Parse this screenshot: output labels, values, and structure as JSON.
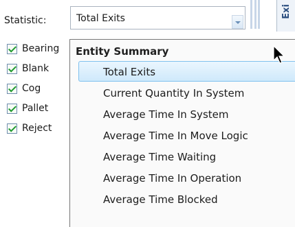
{
  "statistic": {
    "label": "Statistic:",
    "selected_value": "Total Exits",
    "side_tab_text": "Exi"
  },
  "entities": [
    {
      "label": "Bearing",
      "checked": true
    },
    {
      "label": "Blank",
      "checked": true
    },
    {
      "label": "Cog",
      "checked": true
    },
    {
      "label": "Pallet",
      "checked": true
    },
    {
      "label": "Reject",
      "checked": true
    }
  ],
  "dropdown": {
    "group_header": "Entity Summary",
    "options": [
      {
        "label": "Total Exits",
        "selected": true
      },
      {
        "label": "Current Quantity In System",
        "selected": false
      },
      {
        "label": "Average Time In System",
        "selected": false
      },
      {
        "label": "Average Time In Move Logic",
        "selected": false
      },
      {
        "label": "Average Time Waiting",
        "selected": false
      },
      {
        "label": "Average Time In Operation",
        "selected": false
      },
      {
        "label": "Average Time Blocked",
        "selected": false
      }
    ]
  },
  "colors": {
    "selection_border": "#7fc0ee",
    "selection_fill": "#cfe9fb",
    "checkbox_check": "#1f9a2f"
  }
}
